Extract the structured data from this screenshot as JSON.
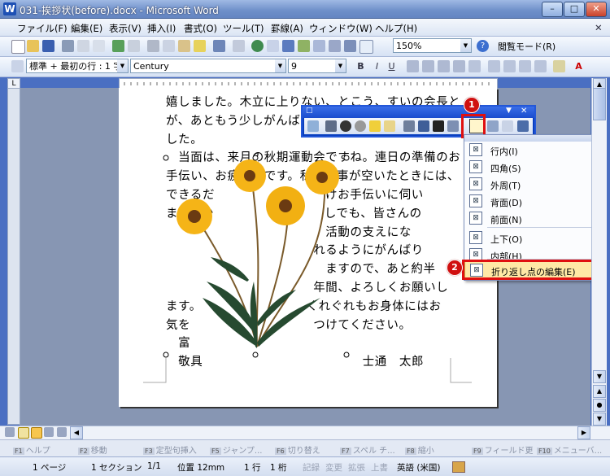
{
  "window": {
    "title": "031-挨拶状(before).docx - Microsoft Word",
    "app_icon": "W",
    "min": "–",
    "max": "□",
    "close": "✕"
  },
  "menu": {
    "file": "ファイル(F)",
    "edit": "編集(E)",
    "view": "表示(V)",
    "insert": "挿入(I)",
    "format": "書式(O)",
    "tools": "ツール(T)",
    "table": "罫線(A)",
    "window": "ウィンドウ(W)",
    "help": "ヘルプ(H)",
    "close_x": "✕"
  },
  "toolbar": {
    "zoom": "150%",
    "reading_mode": "閲覧モード(R)",
    "help_icon": "?"
  },
  "format_toolbar": {
    "style": "標準 + 最初の行 : 1 字",
    "font": "Century",
    "size": "9",
    "bold": "B",
    "italic": "I",
    "underline": "U",
    "font_color": "A"
  },
  "ruler": {
    "corner": "L"
  },
  "document": {
    "lines": [
      "嬉しました。木立に上りない、とこう、すいの会長と",
      "が、あともう少しがんばる",
      "した。",
      "　当面は、来月の秋期運動会ですね。連日の準備のお",
      "手伝い、お疲れ様です。私も仕事が空いたときには、",
      "できるだ　　　　　　　　　けお手伝いに伺い",
      "ます。少　　　　　　　　　しでも、皆さんの",
      "　　　　　　　　　　　　　活動の支えにな",
      "　　　　　　　　　　　　れるようにがんばり",
      "　　　　　　　　　　　　　ますので、あと約半",
      "　　　　　　　　　　　　年間、よろしくお願いし",
      "ます。　　　　　　　　　くれぐれもお身体にはお",
      "気を　　　　　　　　　　つけてください。",
      "　富",
      "　敬具　　　　　　　　　　　　　士通　太郎"
    ]
  },
  "picture_toolbar": {
    "title_icon": "□",
    "close": "✕",
    "menu_arrow": "▼"
  },
  "wrap_menu": {
    "items": [
      {
        "label": "行内(I)",
        "icon": "inline-icon"
      },
      {
        "label": "四角(S)",
        "icon": "square-wrap-icon"
      },
      {
        "label": "外周(T)",
        "icon": "tight-wrap-icon"
      },
      {
        "label": "背面(D)",
        "icon": "behind-text-icon"
      },
      {
        "label": "前面(N)",
        "icon": "in-front-icon"
      },
      {
        "label": "上下(O)",
        "icon": "top-bottom-icon"
      },
      {
        "label": "内部(H)",
        "icon": "through-icon"
      },
      {
        "label": "折り返し点の編集(E)",
        "icon": "edit-wrap-points-icon"
      }
    ]
  },
  "callouts": {
    "one": "1",
    "two": "2"
  },
  "fkeys": [
    {
      "key": "F1",
      "label": "ヘルプ"
    },
    {
      "key": "F2",
      "label": "移動"
    },
    {
      "key": "F3",
      "label": "定型句挿入"
    },
    {
      "key": "F5",
      "label": "ジャンプ..."
    },
    {
      "key": "F6",
      "label": "切り替え"
    },
    {
      "key": "F7",
      "label": "スペル チ..."
    },
    {
      "key": "F8",
      "label": "縮小"
    },
    {
      "key": "F9",
      "label": "フィールド更"
    },
    {
      "key": "F10",
      "label": "メニューバ..."
    }
  ],
  "status": {
    "page": "1 ページ",
    "section": "1 セクション",
    "pages": "1/1",
    "position": "位置 12mm",
    "line": "1 行",
    "column": "1 桁",
    "rec": "記録",
    "trk": "変更",
    "ext": "拡張",
    "ovr": "上書",
    "lang": "英語 (米国)"
  }
}
